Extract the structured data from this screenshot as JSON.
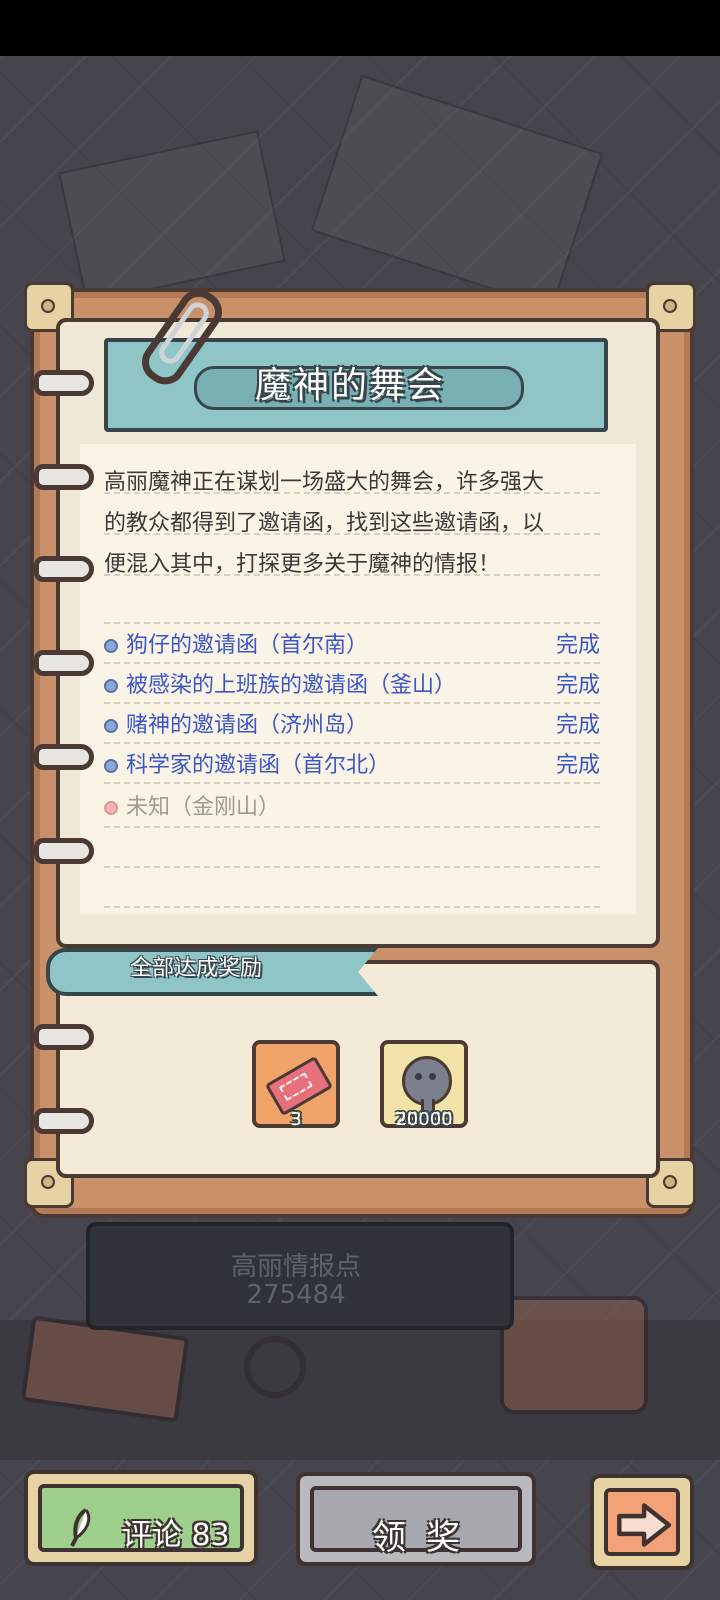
{
  "quest": {
    "title": "魔神的舞会",
    "description_lines": [
      "高丽魔神正在谋划一场盛大的舞会，许多强大",
      "的教众都得到了邀请函，找到这些邀请函，以",
      "便混入其中，打探更多关于魔神的情报！"
    ],
    "tasks": [
      {
        "name": "狗仔的邀请函（首尔南）",
        "status": "完成"
      },
      {
        "name": "被感染的上班族的邀请函（釜山）",
        "status": "完成"
      },
      {
        "name": "赌神的邀请函（济州岛）",
        "status": "完成"
      },
      {
        "name": "科学家的邀请函（首尔北）",
        "status": "完成"
      },
      {
        "name": "未知（金刚山）",
        "status": ""
      }
    ]
  },
  "reward": {
    "title": "全部达成奖励",
    "items": [
      {
        "icon": "ticket-icon",
        "count": "3"
      },
      {
        "icon": "spirit-orb-icon",
        "count": "20000"
      }
    ]
  },
  "intel": {
    "label": "高丽情报点",
    "value": "275484"
  },
  "buttons": {
    "comment": "评论 83",
    "claim": "领奖",
    "next_icon": "arrow-right-icon"
  },
  "colors": {
    "accent_teal": "#8fc5c7",
    "task_blue": "#3b57c7",
    "comment_green": "#9fcf8d",
    "next_orange": "#f3a177"
  }
}
